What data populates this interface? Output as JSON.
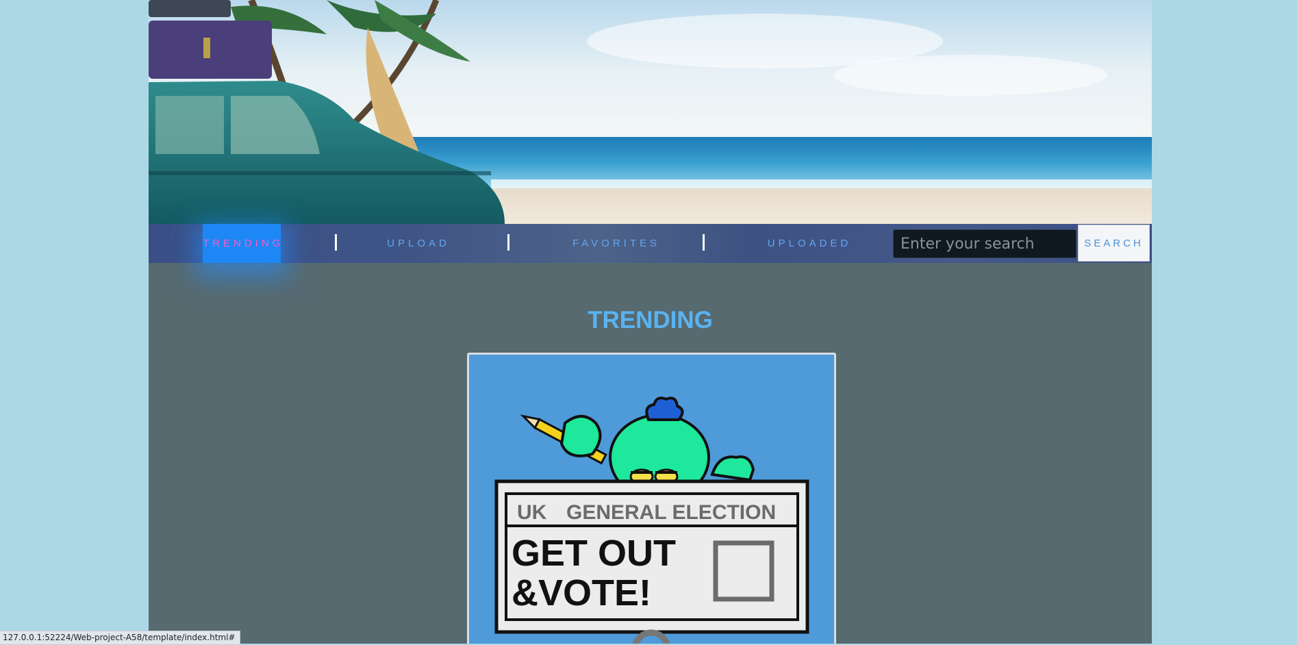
{
  "nav": {
    "items": [
      {
        "label": "TRENDING",
        "active": true
      },
      {
        "label": "UPLOAD",
        "active": false
      },
      {
        "label": "FAVORITES",
        "active": false
      },
      {
        "label": "UPLOADED",
        "active": false
      }
    ],
    "search_placeholder": "Enter your search",
    "search_button": "SEARCH"
  },
  "main": {
    "heading": "TRENDING",
    "gif": {
      "line1": "UK",
      "line1b": "GENERAL ELECTION",
      "line2": "GET OUT",
      "line3": "&VOTE!"
    }
  },
  "status_url": "127.0.0.1:52224/Web-project-A58/template/index.html#",
  "colors": {
    "page_bg": "#acd8e6",
    "content_bg": "#576a70",
    "accent": "#59b3f2",
    "active_tab": "#1d88f5",
    "active_text": "#ff59c8"
  }
}
